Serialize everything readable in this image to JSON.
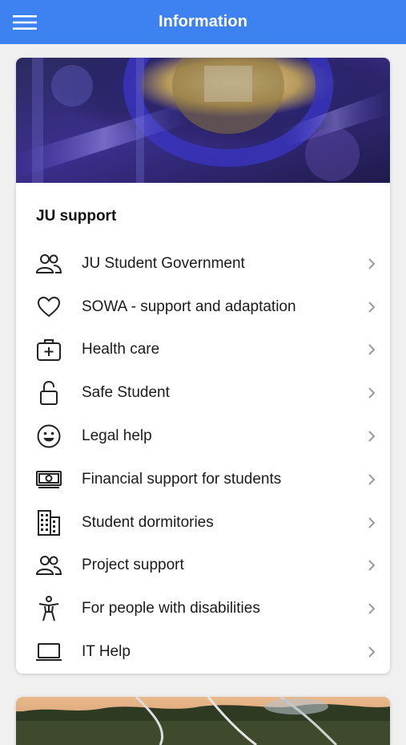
{
  "appbar": {
    "title": "Information",
    "background_color": "#3d82f0",
    "menu_icon": "hamburger-menu-icon"
  },
  "support_card": {
    "banner": "laboratory-equipment-photo",
    "title": "JU support",
    "items": [
      {
        "label": "JU Student Government",
        "icon": "people-icon"
      },
      {
        "label": "SOWA - support and adaptation",
        "icon": "heart-icon"
      },
      {
        "label": "Health care",
        "icon": "medical-kit-icon"
      },
      {
        "label": "Safe Student",
        "icon": "unlocked-padlock-icon"
      },
      {
        "label": "Legal help",
        "icon": "smiley-face-icon"
      },
      {
        "label": "Financial support for students",
        "icon": "money-icon"
      },
      {
        "label": "Student dormitories",
        "icon": "building-icon"
      },
      {
        "label": "Project support",
        "icon": "people-icon"
      },
      {
        "label": "For people with disabilities",
        "icon": "accessibility-person-icon"
      },
      {
        "label": "IT Help",
        "icon": "laptop-icon"
      }
    ]
  },
  "next_card": {
    "banner": "outdoor-landscape-photo"
  }
}
